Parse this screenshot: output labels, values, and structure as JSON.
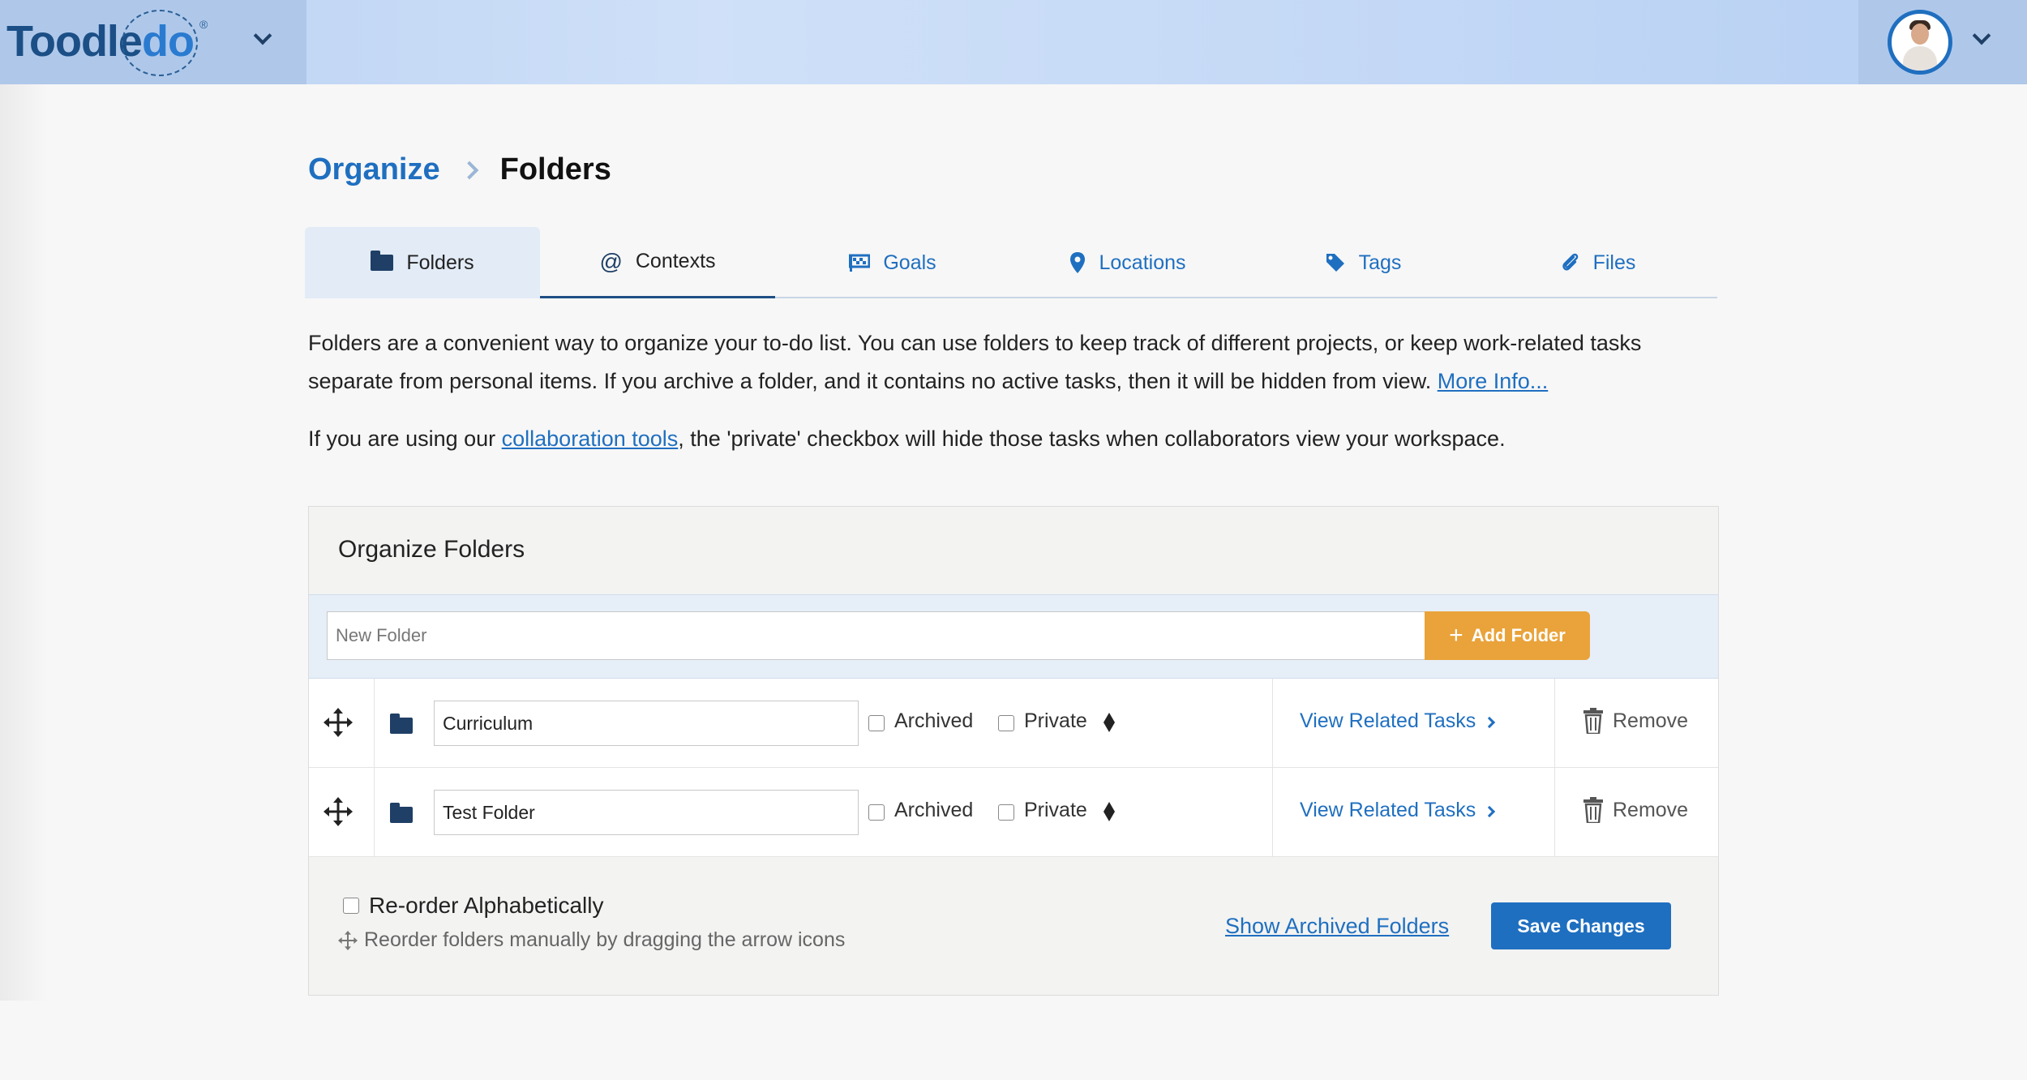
{
  "header": {
    "logo_text_a": "Toodle",
    "logo_text_b": "do",
    "logo_reg": "®"
  },
  "breadcrumb": {
    "parent": "Organize",
    "current": "Folders"
  },
  "tabs": [
    {
      "label": "Folders",
      "icon": "folder-icon"
    },
    {
      "label": "Contexts",
      "icon": "at-icon"
    },
    {
      "label": "Goals",
      "icon": "goal-flag-icon"
    },
    {
      "label": "Locations",
      "icon": "map-pin-icon"
    },
    {
      "label": "Tags",
      "icon": "tag-icon"
    },
    {
      "label": "Files",
      "icon": "paperclip-icon"
    }
  ],
  "description": {
    "para1": "Folders are a convenient way to organize your to-do list. You can use folders to keep track of different projects, or keep work-related tasks separate from personal items. If you archive a folder, and it contains no active tasks, then it will be hidden from view. ",
    "more_info": "More Info...",
    "para2_a": "If you are using our ",
    "collab_link": "collaboration tools",
    "para2_b": ", the 'private' checkbox will hide those tasks when collaborators view your workspace."
  },
  "panel": {
    "title": "Organize Folders",
    "new_folder_placeholder": "New Folder",
    "add_button": "Add Folder",
    "plus": "+",
    "archived_label": "Archived",
    "private_label": "Private",
    "related_label": "View Related Tasks",
    "remove_label": "Remove",
    "folders": [
      {
        "name": "Curriculum",
        "archived": false,
        "private": false
      },
      {
        "name": "Test Folder",
        "archived": false,
        "private": false
      }
    ],
    "reorder_label": "Re-order Alphabetically",
    "reorder_hint": "Reorder folders manually by dragging the arrow icons",
    "show_archived": "Show Archived Folders",
    "save_button": "Save Changes"
  },
  "colors": {
    "accent": "#1f6fc0",
    "add_button": "#e9a33a",
    "header_bg": "#c3d8f6"
  }
}
